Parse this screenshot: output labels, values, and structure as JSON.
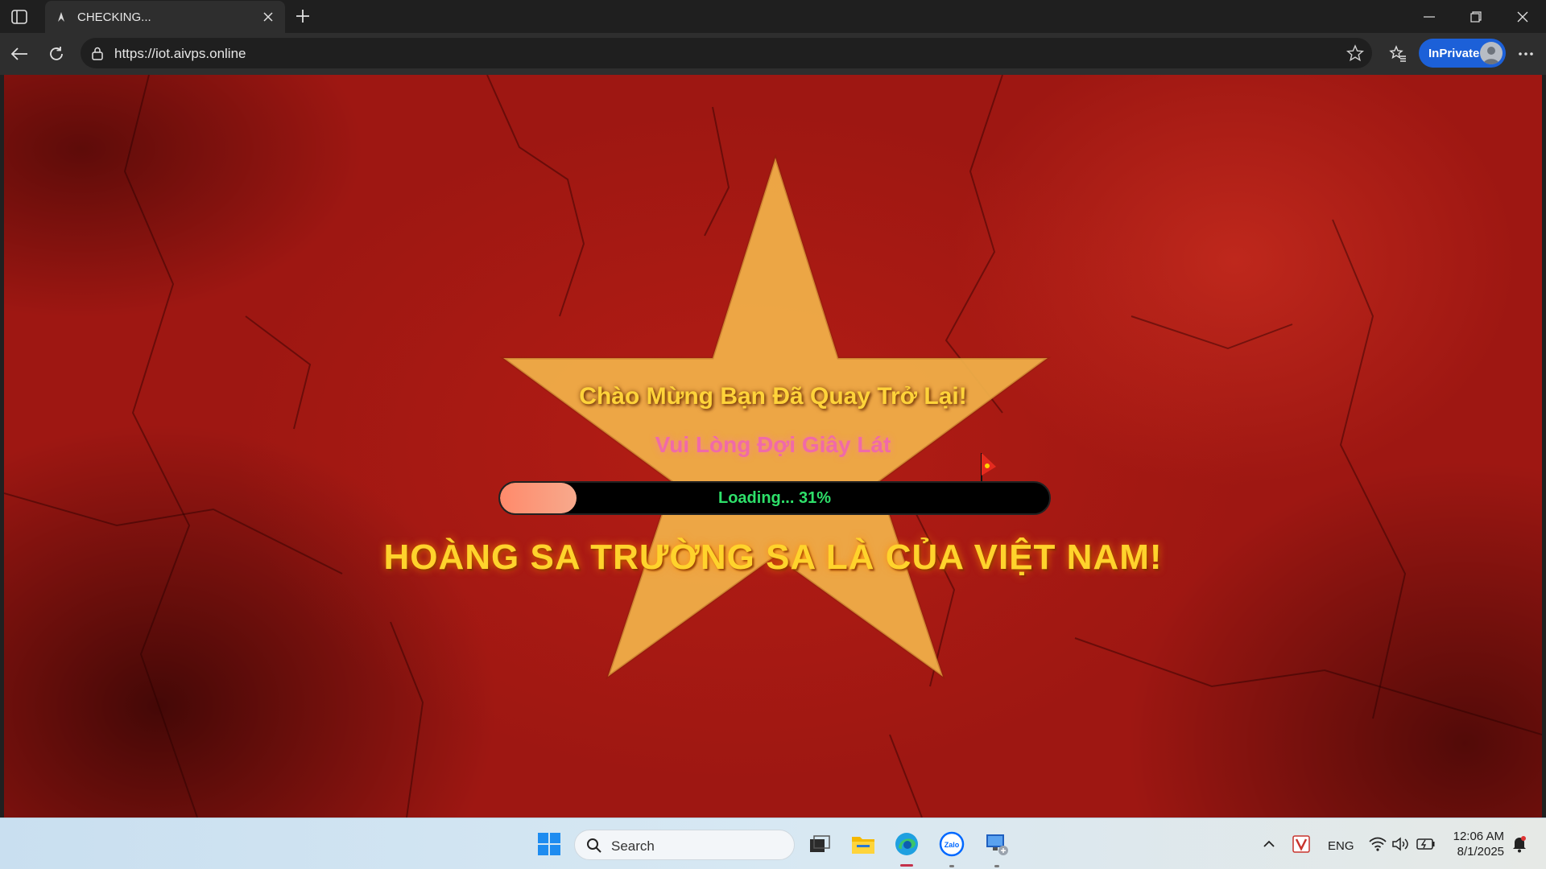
{
  "browser": {
    "tab_title": "CHECKING...",
    "url": "https://iot.aivps.online",
    "inprivate_label": "InPrivate"
  },
  "page": {
    "welcome": "Chào Mừng Bạn Đã Quay Trở Lại!",
    "wait": "Vui Lòng Đợi Giây Lát",
    "progress_label": "Loading... 31%",
    "progress_fraction": 0.14,
    "slogan": "HOÀNG SA TRƯỜNG SA LÀ CỦA VIỆT NAM!"
  },
  "taskbar": {
    "search_label": "Search",
    "language": "ENG",
    "time": "12:06 AM",
    "date": "8/1/2025",
    "apps": [
      "windows-start-icon",
      "task-view-icon",
      "file-explorer-icon",
      "edge-icon",
      "zalo-icon",
      "remote-desktop-icon"
    ]
  },
  "colors": {
    "background_red": "#9e1712",
    "star_yellow": "#f2b24a",
    "title_yellow": "#ffd33a",
    "wait_pink": "#f06aa8",
    "progress_text_green": "#2ee06a",
    "inprivate_blue": "#1c60d8"
  }
}
